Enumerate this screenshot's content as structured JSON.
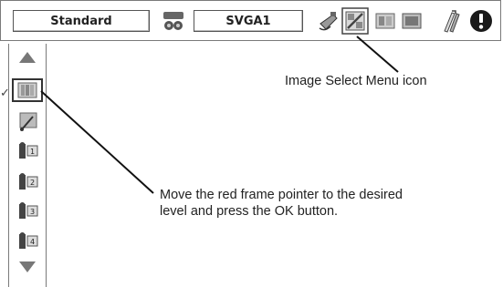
{
  "menubar": {
    "mode_label": "Standard",
    "input_label": "SVGA1",
    "icons": [
      "mode-icon",
      "pc-adjust-icon",
      "image-select-icon",
      "image-adjust-icon",
      "screen-icon",
      "setting-icon",
      "info-icon"
    ]
  },
  "sidebar": {
    "items": [
      {
        "name": "scroll-up-arrow"
      },
      {
        "name": "image-level-1",
        "selected": true
      },
      {
        "name": "image-level-2"
      },
      {
        "name": "image-level-3"
      },
      {
        "name": "image-level-4"
      },
      {
        "name": "image-level-5"
      },
      {
        "name": "image-level-6"
      },
      {
        "name": "scroll-down-arrow"
      }
    ],
    "checkmark": "✓"
  },
  "callouts": {
    "image_select": "Image Select Menu icon",
    "pointer_line1": "Move the red frame pointer to the desired",
    "pointer_line2": "level and press the OK button."
  }
}
